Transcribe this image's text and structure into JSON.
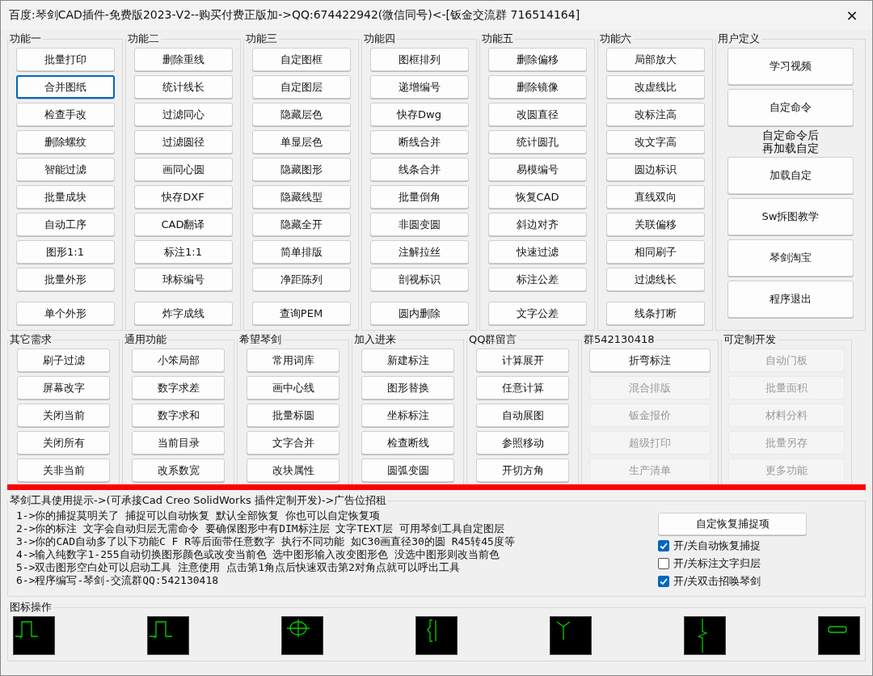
{
  "window": {
    "title": "百度:琴剑CAD插件-免费版2023-V2--购买付费正版加->QQ:674422942(微信同号)<-[钣金交流群 716514164]",
    "close": "✕"
  },
  "top_groups": [
    {
      "title": "功能一",
      "buttons": [
        {
          "label": "批量打印",
          "focused": false
        },
        {
          "label": "合并图纸",
          "focused": true
        },
        {
          "label": "检查手改",
          "focused": false
        },
        {
          "label": "删除螺纹",
          "focused": false
        },
        {
          "label": "智能过滤",
          "focused": false
        },
        {
          "label": "批量成块",
          "focused": false
        },
        {
          "label": "自动工序",
          "focused": false
        },
        {
          "label": "图形1:1",
          "focused": false
        },
        {
          "label": "批量外形",
          "focused": false
        },
        {
          "label": "单个外形",
          "focused": false
        }
      ]
    },
    {
      "title": "功能二",
      "buttons": [
        {
          "label": "删除重线",
          "focused": false
        },
        {
          "label": "统计线长",
          "focused": false
        },
        {
          "label": "过滤同心",
          "focused": false
        },
        {
          "label": "过滤圆径",
          "focused": false
        },
        {
          "label": "画同心圆",
          "focused": false
        },
        {
          "label": "快存DXF",
          "focused": false
        },
        {
          "label": "CAD翻译",
          "focused": false
        },
        {
          "label": "标注1:1",
          "focused": false
        },
        {
          "label": "球标编号",
          "focused": false
        },
        {
          "label": "炸字成线",
          "focused": false
        }
      ]
    },
    {
      "title": "功能三",
      "buttons": [
        {
          "label": "自定图框",
          "focused": false
        },
        {
          "label": "自定图层",
          "focused": false
        },
        {
          "label": "隐藏层色",
          "focused": false
        },
        {
          "label": "单显层色",
          "focused": false
        },
        {
          "label": "隐藏图形",
          "focused": false
        },
        {
          "label": "隐藏线型",
          "focused": false
        },
        {
          "label": "隐藏全开",
          "focused": false
        },
        {
          "label": "简单排版",
          "focused": false
        },
        {
          "label": "净距陈列",
          "focused": false
        },
        {
          "label": "查询PEM",
          "focused": false
        }
      ]
    },
    {
      "title": "功能四",
      "buttons": [
        {
          "label": "图框排列",
          "focused": false
        },
        {
          "label": "递增编号",
          "focused": false
        },
        {
          "label": "快存Dwg",
          "focused": false
        },
        {
          "label": "断线合并",
          "focused": false
        },
        {
          "label": "线条合并",
          "focused": false
        },
        {
          "label": "批量倒角",
          "focused": false
        },
        {
          "label": "非圆变圆",
          "focused": false
        },
        {
          "label": "注解拉丝",
          "focused": false
        },
        {
          "label": "剖视标识",
          "focused": false
        },
        {
          "label": "圆内删除",
          "focused": false
        }
      ]
    },
    {
      "title": "功能五",
      "buttons": [
        {
          "label": "删除偏移",
          "focused": false
        },
        {
          "label": "删除镜像",
          "focused": false
        },
        {
          "label": "改圆直径",
          "focused": false
        },
        {
          "label": "统计圆孔",
          "focused": false
        },
        {
          "label": "易模编号",
          "focused": false
        },
        {
          "label": "恢复CAD",
          "focused": false
        },
        {
          "label": "斜边对齐",
          "focused": false
        },
        {
          "label": "快速过滤",
          "focused": false
        },
        {
          "label": "标注公差",
          "focused": false
        },
        {
          "label": "文字公差",
          "focused": false
        }
      ]
    },
    {
      "title": "功能六",
      "buttons": [
        {
          "label": "局部放大",
          "focused": false
        },
        {
          "label": "改虚线比",
          "focused": false
        },
        {
          "label": "改标注高",
          "focused": false
        },
        {
          "label": "改文字高",
          "focused": false
        },
        {
          "label": "圆边标识",
          "focused": false
        },
        {
          "label": "直线双向",
          "focused": false
        },
        {
          "label": "关联偏移",
          "focused": false
        },
        {
          "label": "相同刷子",
          "focused": false
        },
        {
          "label": "过滤线长",
          "focused": false
        },
        {
          "label": "线条打断",
          "focused": false
        }
      ]
    }
  ],
  "user_group": {
    "title": "用户定义",
    "buttons_before": [
      "学习视频",
      "自定命令"
    ],
    "note_lines": [
      "自定命令后",
      "再加载自定"
    ],
    "buttons_after": [
      "加载自定",
      "Sw拆图教学",
      "琴剑淘宝",
      "程序退出"
    ]
  },
  "bottom_groups": [
    {
      "title": "其它需求",
      "buttons": [
        {
          "label": "刷子过滤",
          "disabled": false
        },
        {
          "label": "屏幕改字",
          "disabled": false
        },
        {
          "label": "关闭当前",
          "disabled": false
        },
        {
          "label": "关闭所有",
          "disabled": false
        },
        {
          "label": "关非当前",
          "disabled": false
        }
      ]
    },
    {
      "title": "通用功能",
      "buttons": [
        {
          "label": "小笨局部",
          "disabled": false
        },
        {
          "label": "数字求差",
          "disabled": false
        },
        {
          "label": "数字求和",
          "disabled": false
        },
        {
          "label": "当前目录",
          "disabled": false
        },
        {
          "label": "改系数宽",
          "disabled": false
        }
      ]
    },
    {
      "title": "希望琴剑",
      "buttons": [
        {
          "label": "常用词库",
          "disabled": false
        },
        {
          "label": "画中心线",
          "disabled": false
        },
        {
          "label": "批量标圆",
          "disabled": false
        },
        {
          "label": "文字合并",
          "disabled": false
        },
        {
          "label": "改块属性",
          "disabled": false
        }
      ]
    },
    {
      "title": "加入进来",
      "buttons": [
        {
          "label": "新建标注",
          "disabled": false
        },
        {
          "label": "图形替换",
          "disabled": false
        },
        {
          "label": "坐标标注",
          "disabled": false
        },
        {
          "label": "检查断线",
          "disabled": false
        },
        {
          "label": "圆弧变圆",
          "disabled": false
        }
      ]
    },
    {
      "title": "QQ群留言",
      "buttons": [
        {
          "label": "计算展开",
          "disabled": false
        },
        {
          "label": "任意计算",
          "disabled": false
        },
        {
          "label": "自动展图",
          "disabled": false
        },
        {
          "label": "参照移动",
          "disabled": false
        },
        {
          "label": "开切方角",
          "disabled": false
        }
      ]
    },
    {
      "title": "群542130418",
      "buttons": [
        {
          "label": "折弯标注",
          "disabled": false
        },
        {
          "label": "混合排版",
          "disabled": true
        },
        {
          "label": "钣金报价",
          "disabled": true
        },
        {
          "label": "超级打印",
          "disabled": true
        },
        {
          "label": "生产清单",
          "disabled": true
        }
      ]
    },
    {
      "title": "可定制开发",
      "buttons": [
        {
          "label": "自动门板",
          "disabled": true
        },
        {
          "label": "批量面积",
          "disabled": true
        },
        {
          "label": "材料分料",
          "disabled": true
        },
        {
          "label": "批量另存",
          "disabled": true
        },
        {
          "label": "更多功能",
          "disabled": true
        }
      ]
    }
  ],
  "tips": {
    "title": "琴剑工具使用提示->(可承接Cad Creo SolidWorks 插件定制开发)->广告位招租",
    "lines": [
      "1->你的捕捉莫明关了 捕捉可以自动恢复 默认全部恢复 你也可以自定恢复项",
      "2->你的标注 文字会自动归层无需命令 要确保图形中有DIM标注层 文字TEXT层 可用琴剑工具自定图层",
      "3->你的CAD自动多了以下功能C F R等后面带任意数字 执行不同功能 如C30画直径30的圆 R45转45度等",
      "4->输入纯数字1-255自动切换图形颜色或改变当前色 选中图形输入改变图形色 没选中图形则改当前色",
      "5->双击图形空白处可以启动工具 注意使用 点击第1角点后快速双击第2对角点就可以呼出工具",
      "6->程序编写-琴剑-交流群QQ:542130418"
    ],
    "button": "自定恢复捕捉项",
    "options": [
      {
        "label": "开/关自动恢复捕捉",
        "checked": true
      },
      {
        "label": "开/关标注文字归层",
        "checked": false
      },
      {
        "label": "开/关双击招唤琴剑",
        "checked": true
      }
    ]
  },
  "icon_bar": {
    "title": "图标操作",
    "icons": [
      {
        "kind": "pulse"
      },
      {
        "kind": "pulse"
      },
      {
        "kind": "target"
      },
      {
        "kind": "bracket"
      },
      {
        "kind": "fork"
      },
      {
        "kind": "break"
      },
      {
        "kind": "slot"
      }
    ]
  }
}
